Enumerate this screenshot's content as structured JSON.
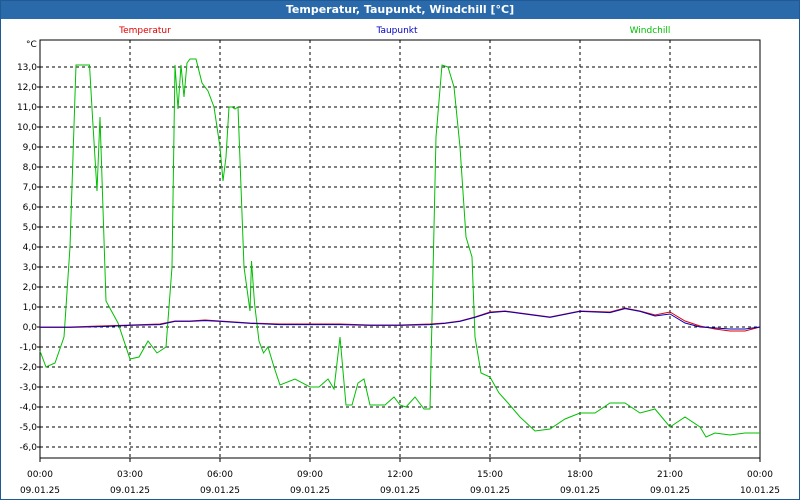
{
  "window": {
    "title": "Temperatur, Taupunkt, Windchill [°C]"
  },
  "colors": {
    "temperatur": "#e00000",
    "taupunkt": "#0000c0",
    "windchill": "#00c000",
    "titlebar": "#2a6aab"
  },
  "chart_data": {
    "type": "line",
    "title": "Temperatur, Taupunkt, Windchill [°C]",
    "ylabel": "°C",
    "xlabel": "",
    "ylim": [
      -6.5,
      14.0
    ],
    "xlim_hours": [
      0,
      24
    ],
    "grid": true,
    "legend_placement": "top",
    "y_ticks": [
      "13,0",
      "12,0",
      "11,0",
      "10,0",
      "9,0",
      "8,0",
      "7,0",
      "6,0",
      "5,0",
      "4,0",
      "3,0",
      "2,0",
      "1,0",
      "0,0",
      "-1,0",
      "-2,0",
      "-3,0",
      "-4,0",
      "-5,0",
      "-6,0"
    ],
    "y_tick_values": [
      13,
      12,
      11,
      10,
      9,
      8,
      7,
      6,
      5,
      4,
      3,
      2,
      1,
      0,
      -1,
      -2,
      -3,
      -4,
      -5,
      -6
    ],
    "x_ticks": [
      {
        "h": 0,
        "time": "00:00",
        "date": "09.01.25"
      },
      {
        "h": 3,
        "time": "03:00",
        "date": "09.01.25"
      },
      {
        "h": 6,
        "time": "06:00",
        "date": "09.01.25"
      },
      {
        "h": 9,
        "time": "09:00",
        "date": "09.01.25"
      },
      {
        "h": 12,
        "time": "12:00",
        "date": "09.01.25"
      },
      {
        "h": 15,
        "time": "15:00",
        "date": "09.01.25"
      },
      {
        "h": 18,
        "time": "18:00",
        "date": "09.01.25"
      },
      {
        "h": 21,
        "time": "21:00",
        "date": "09.01.25"
      },
      {
        "h": 24,
        "time": "00:00",
        "date": "10.01.25"
      }
    ],
    "series": [
      {
        "name": "Temperatur",
        "color": "#e00000",
        "x": [
          0,
          1,
          2,
          3,
          4,
          4.5,
          5,
          5.5,
          6,
          7,
          8,
          9,
          10,
          11,
          12,
          13,
          13.5,
          14,
          14.5,
          15,
          15.5,
          16,
          16.5,
          17,
          18,
          19,
          19.5,
          20,
          20.5,
          21,
          21.5,
          22,
          22.5,
          23,
          23.5,
          24
        ],
        "y": [
          0,
          0,
          0.05,
          0.1,
          0.15,
          0.3,
          0.3,
          0.35,
          0.3,
          0.2,
          0.15,
          0.15,
          0.15,
          0.1,
          0.1,
          0.15,
          0.2,
          0.3,
          0.5,
          0.75,
          0.8,
          0.7,
          0.6,
          0.5,
          0.8,
          0.75,
          0.95,
          0.8,
          0.6,
          0.75,
          0.3,
          0.05,
          -0.1,
          -0.2,
          -0.2,
          0.0
        ]
      },
      {
        "name": "Taupunkt",
        "color": "#0000c0",
        "x": [
          0,
          1,
          2,
          3,
          4,
          4.5,
          5,
          5.5,
          6,
          7,
          8,
          9,
          10,
          11,
          12,
          13,
          13.5,
          14,
          14.5,
          15,
          15.5,
          16,
          16.5,
          17,
          18,
          19,
          19.5,
          20,
          20.5,
          21,
          21.5,
          22,
          22.5,
          23,
          23.5,
          24
        ],
        "y": [
          -0.02,
          -0.02,
          0.02,
          0.08,
          0.12,
          0.28,
          0.28,
          0.32,
          0.28,
          0.18,
          0.12,
          0.12,
          0.12,
          0.08,
          0.08,
          0.12,
          0.18,
          0.28,
          0.48,
          0.72,
          0.78,
          0.68,
          0.58,
          0.48,
          0.78,
          0.72,
          0.92,
          0.78,
          0.55,
          0.65,
          0.2,
          0.0,
          -0.05,
          -0.1,
          -0.1,
          0.0
        ]
      },
      {
        "name": "Windchill",
        "color": "#00c000",
        "x": [
          0,
          0.2,
          0.5,
          0.8,
          1.0,
          1.2,
          1.4,
          1.5,
          1.65,
          1.75,
          1.9,
          2.0,
          2.2,
          2.6,
          3.0,
          3.3,
          3.6,
          3.9,
          4.2,
          4.4,
          4.5,
          4.6,
          4.7,
          4.8,
          4.9,
          5.0,
          5.2,
          5.4,
          5.6,
          5.8,
          6.0,
          6.1,
          6.2,
          6.3,
          6.4,
          6.5,
          6.6,
          6.8,
          7.0,
          7.05,
          7.15,
          7.3,
          7.45,
          7.6,
          7.8,
          8.0,
          8.5,
          9.0,
          9.3,
          9.6,
          9.8,
          10.0,
          10.2,
          10.4,
          10.6,
          10.8,
          11.0,
          11.2,
          11.5,
          11.8,
          12.0,
          12.2,
          12.5,
          12.8,
          13.0,
          13.2,
          13.4,
          13.6,
          13.8,
          14.0,
          14.2,
          14.4,
          14.5,
          14.7,
          15.0,
          15.3,
          15.6,
          16.0,
          16.5,
          17.0,
          17.5,
          18.0,
          18.5,
          19.0,
          19.5,
          20.0,
          20.5,
          21.0,
          21.5,
          22.0,
          22.2,
          22.5,
          23.0,
          23.5,
          24.0
        ],
        "y": [
          -1.2,
          -2.0,
          -1.8,
          -0.5,
          4.0,
          13.1,
          13.1,
          13.1,
          13.1,
          10.5,
          6.8,
          10.5,
          1.3,
          0.2,
          -1.6,
          -1.5,
          -0.7,
          -1.3,
          -1.0,
          3.0,
          13.1,
          10.9,
          13.1,
          11.5,
          13.2,
          13.4,
          13.4,
          12.2,
          11.8,
          11.0,
          9.0,
          7.3,
          8.5,
          11.0,
          11.0,
          10.9,
          11.0,
          3.0,
          0.8,
          3.3,
          1.2,
          -0.7,
          -1.3,
          -1.0,
          -2.0,
          -2.9,
          -2.6,
          -3.0,
          -3.0,
          -2.6,
          -3.1,
          -0.5,
          -3.9,
          -3.9,
          -2.8,
          -2.6,
          -3.9,
          -3.9,
          -3.9,
          -3.5,
          -3.9,
          -4.0,
          -3.5,
          -4.1,
          -4.1,
          9.5,
          13.1,
          13.0,
          12.0,
          9.0,
          4.5,
          3.5,
          -0.5,
          -2.3,
          -2.5,
          -3.3,
          -3.8,
          -4.5,
          -5.2,
          -5.1,
          -4.6,
          -4.3,
          -4.3,
          -3.8,
          -3.8,
          -4.3,
          -4.1,
          -5.0,
          -4.5,
          -5.0,
          -5.5,
          -5.3,
          -5.4,
          -5.3,
          -5.3
        ]
      }
    ]
  }
}
